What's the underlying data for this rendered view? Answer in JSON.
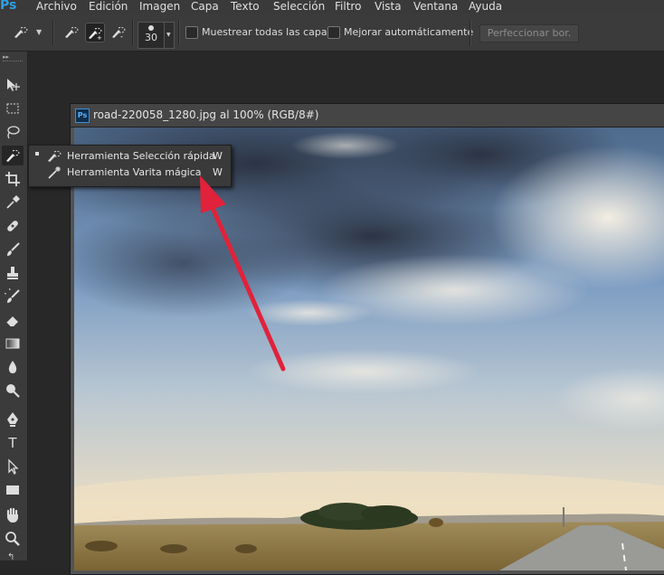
{
  "menu": {
    "logo": "Ps",
    "items": [
      "Archivo",
      "Edición",
      "Imagen",
      "Capa",
      "Texto",
      "Selección",
      "Filtro",
      "Vista",
      "Ventana",
      "Ayuda"
    ]
  },
  "options": {
    "brush_size": "30",
    "sample_all_layers_label": "Muestrear todas las capas",
    "auto_enhance_label": "Mejorar automáticamente",
    "refine_edge_label": "Perfeccionar bor."
  },
  "toolbar": {
    "tools": [
      "move-icon",
      "marquee-icon",
      "lasso-icon",
      "quick-selection-icon",
      "crop-icon",
      "eyedropper-icon",
      "healing-icon",
      "brush-icon",
      "stamp-icon",
      "history-brush-icon",
      "eraser-icon",
      "gradient-icon",
      "blur-icon",
      "dodge-icon",
      "pen-icon",
      "type-icon",
      "path-selection-icon",
      "shape-icon",
      "hand-icon",
      "zoom-icon"
    ],
    "type_glyph": "T"
  },
  "document": {
    "ps_badge": "Ps",
    "title": "road-220058_1280.jpg al 100% (RGB/8#)"
  },
  "flyout": {
    "items": [
      {
        "label": "Herramienta Selección rápida",
        "key": "W"
      },
      {
        "label": "Herramienta Varita mágica",
        "key": "W"
      }
    ]
  },
  "colors": {
    "accent": "#2d9fe6",
    "arrow": "#e0223a"
  }
}
